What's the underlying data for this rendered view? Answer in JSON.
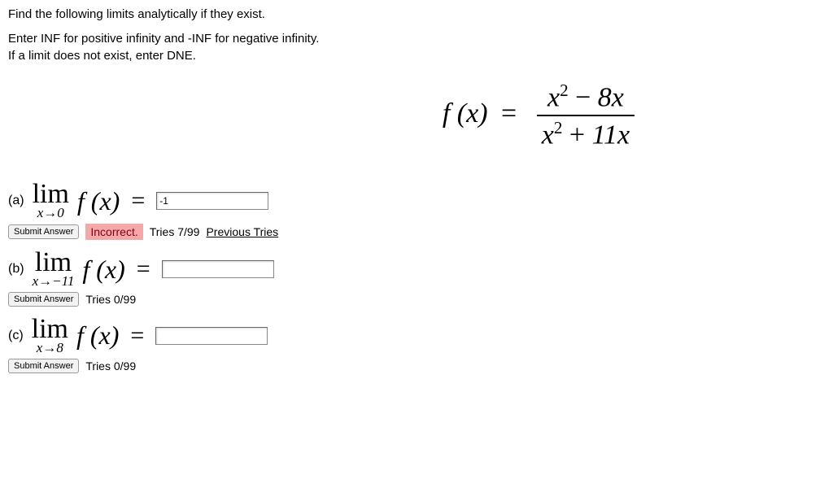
{
  "intro": {
    "line1": "Find the following limits analytically if they exist.",
    "line2": "Enter INF for positive infinity and -INF for negative infinity.",
    "line3": "If a limit does not exist, enter DNE."
  },
  "formula": {
    "lhs": "f (x)",
    "eq": "=",
    "num_tex": "x² − 8x",
    "den_tex": "x² + 11x"
  },
  "parts": {
    "a": {
      "label": "(a)",
      "lim": "lim",
      "approach": "x→0",
      "fx": "f (x)",
      "eq": "=",
      "value": "-1",
      "submit": "Submit Answer",
      "status": "Incorrect.",
      "tries": "Tries 7/99",
      "prev": "Previous Tries"
    },
    "b": {
      "label": "(b)",
      "lim": "lim",
      "approach": "x→−11",
      "fx": "f (x)",
      "eq": "=",
      "value": "",
      "submit": "Submit Answer",
      "tries": "Tries 0/99"
    },
    "c": {
      "label": "(c)",
      "lim": "lim",
      "approach": "x→8",
      "fx": "f (x)",
      "eq": "=",
      "value": "",
      "submit": "Submit Answer",
      "tries": "Tries 0/99"
    }
  }
}
